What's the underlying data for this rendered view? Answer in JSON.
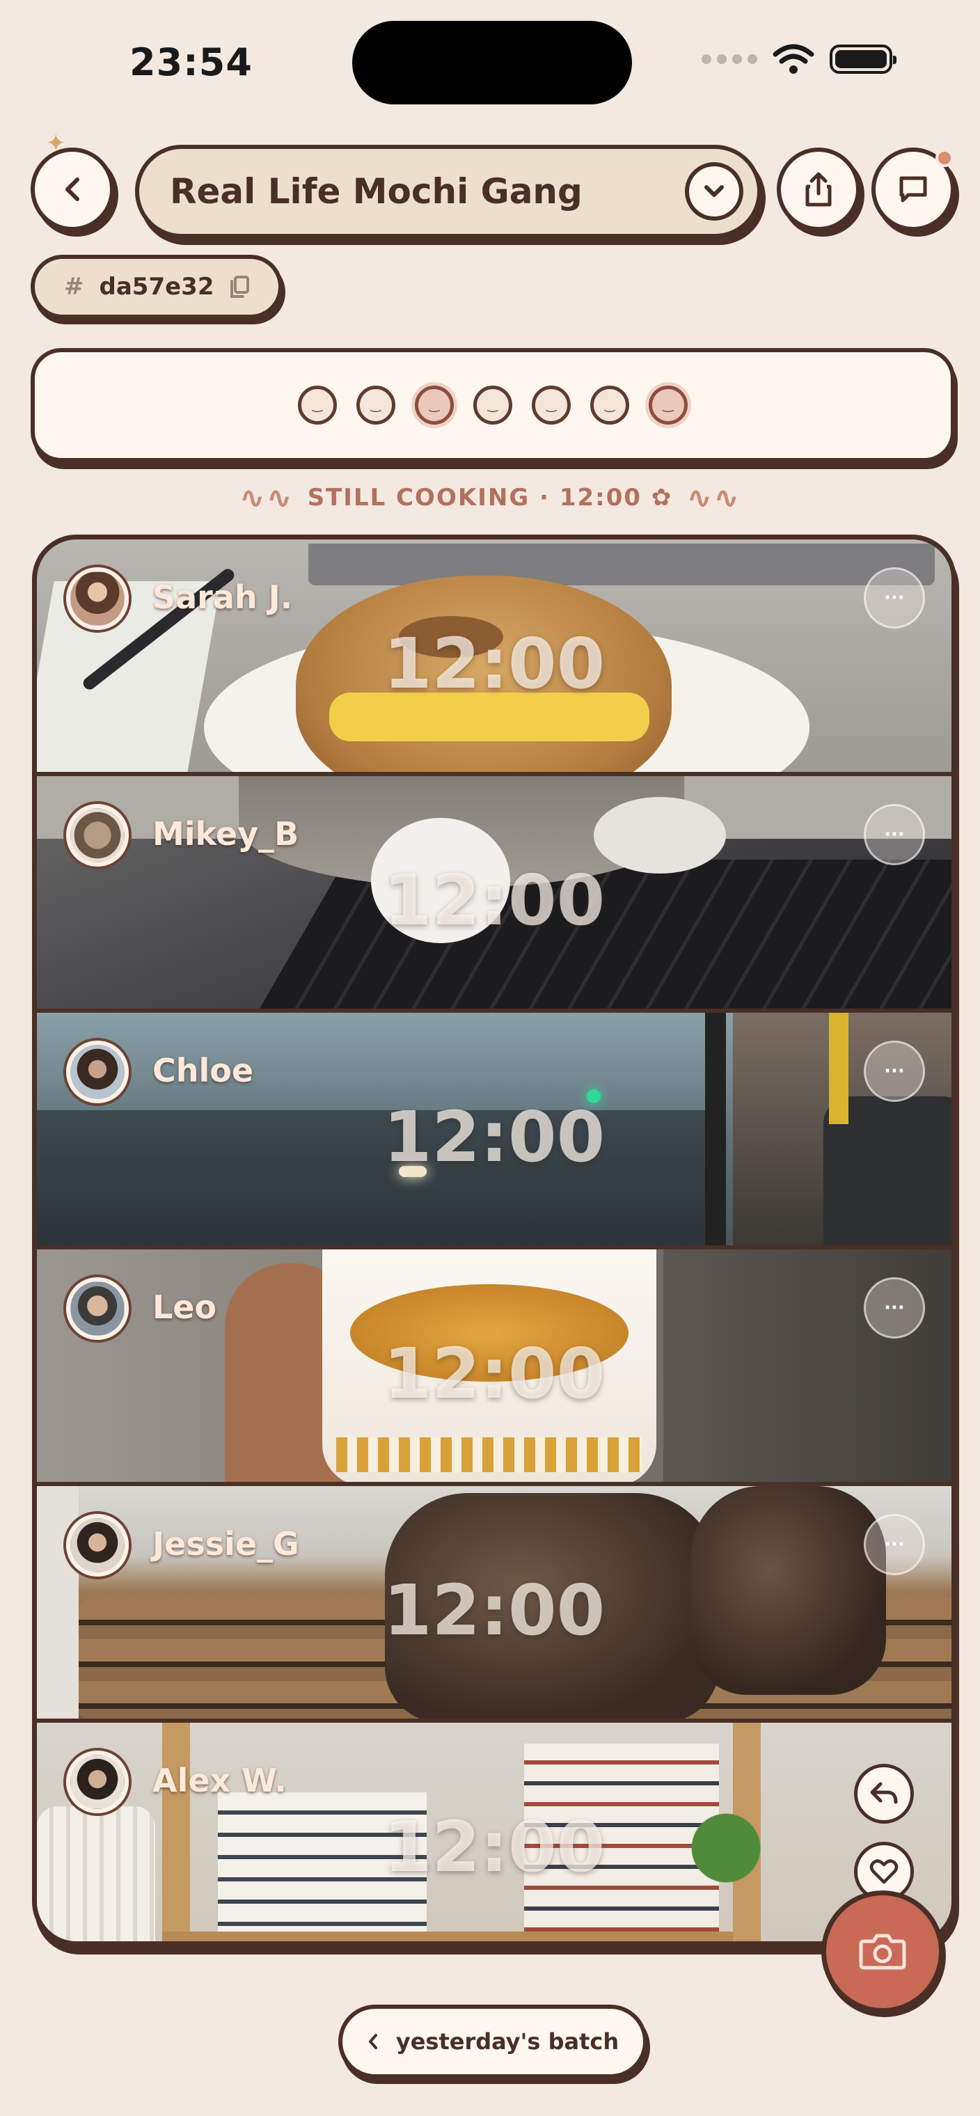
{
  "status_bar": {
    "time": "23:54"
  },
  "header": {
    "back_icon": "chevron-left-icon",
    "group_name": "Real Life Mochi Gang",
    "dropdown_icon": "chevron-down-icon",
    "share_icon": "share-icon",
    "chat_icon": "chat-bubble-icon",
    "notification_color": "#d98d6e"
  },
  "group_code": {
    "prefix": "#",
    "code": "da57e32",
    "copy_icon": "copy-icon"
  },
  "progress": {
    "faces": [
      {
        "active": false
      },
      {
        "active": false
      },
      {
        "active": true
      },
      {
        "active": false
      },
      {
        "active": false
      },
      {
        "active": false
      },
      {
        "active": true
      }
    ]
  },
  "cooking_status": "STILL COOKING · 12:00",
  "cooking_icon": "flower-icon",
  "feed": {
    "posts": [
      {
        "user": "Sarah J.",
        "timer": "12:00",
        "scene": "bagel on plate at desk"
      },
      {
        "user": "Mikey_B",
        "timer": "12:00",
        "scene": "cat paws on laptop keyboard"
      },
      {
        "user": "Chloe",
        "timer": "12:00",
        "scene": "rainy bus window"
      },
      {
        "user": "Leo",
        "timer": "12:00",
        "scene": "cup noodles in hand"
      },
      {
        "user": "Jessie_G",
        "timer": "12:00",
        "scene": "muddy boots on doormat"
      },
      {
        "user": "Alex W.",
        "timer": "12:00",
        "scene": "bookshelf with plants"
      }
    ],
    "more_label": "···"
  },
  "actions": {
    "reply_icon": "reply-icon",
    "like_icon": "heart-icon",
    "camera_icon": "camera-icon",
    "camera_color": "#c86a55"
  },
  "footer": {
    "yesterday_label": "yesterday's batch"
  },
  "colors": {
    "background": "#f3e9e0",
    "outline": "#4a2f26",
    "accent": "#b2715f"
  }
}
